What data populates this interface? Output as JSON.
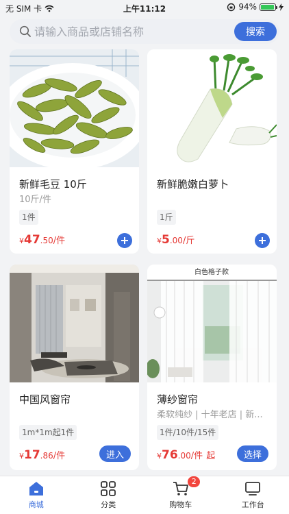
{
  "status_bar": {
    "carrier": "无 SIM 卡",
    "time": "上午11:12",
    "battery": "94%",
    "battery_level": 0.94
  },
  "search": {
    "placeholder": "请输入商品或店铺名称",
    "button_label": "搜索"
  },
  "products": [
    {
      "title": "新鲜毛豆 10斤",
      "subtitle": "10斤/件",
      "spec": "1件",
      "currency": "¥",
      "price_int": "47",
      "price_dec": ".50",
      "price_unit": "/件",
      "action": "add",
      "image": "edamame"
    },
    {
      "title": "新鲜脆嫩白萝卜",
      "subtitle": "",
      "spec": "1斤",
      "currency": "¥",
      "price_int": "5",
      "price_dec": ".00",
      "price_unit": "/斤",
      "action": "add",
      "image": "daikon-radish"
    },
    {
      "title": "中国风窗帘",
      "subtitle": "",
      "spec": "1m*1m起1件",
      "currency": "¥",
      "price_int": "17",
      "price_dec": ".86",
      "price_unit": "/件",
      "action_label": "进入",
      "image": "living-room-curtain"
    },
    {
      "title": "薄纱窗帘",
      "subtitle": "柔软纯纱 | 十年老店 | 新...",
      "spec": "1件/10件/15件",
      "currency": "¥",
      "price_int": "76",
      "price_dec": ".00",
      "price_unit": "/件",
      "price_suffix": "起",
      "action_label": "选择",
      "image": "sheer-curtain",
      "image_caption": "白色格子款"
    }
  ],
  "tabs": [
    {
      "label": "商城",
      "icon": "home-icon",
      "active": true
    },
    {
      "label": "分类",
      "icon": "grid-icon",
      "active": false
    },
    {
      "label": "购物车",
      "icon": "cart-icon",
      "active": false,
      "badge": "2"
    },
    {
      "label": "工作台",
      "icon": "monitor-icon",
      "active": false
    }
  ],
  "colors": {
    "accent": "#3d6fdb",
    "price": "#e53935",
    "badge": "#f2453d",
    "battery": "#34c759"
  }
}
